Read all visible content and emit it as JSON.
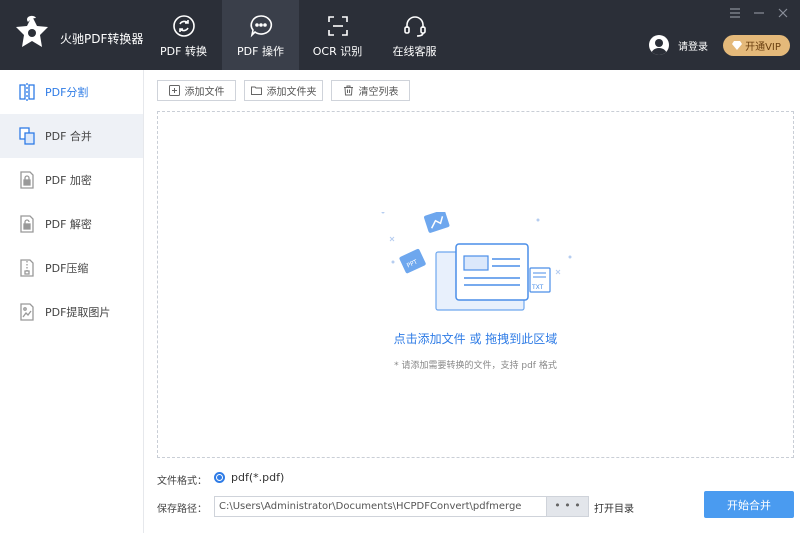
{
  "app": {
    "title": "火驰PDF转换器"
  },
  "nav": {
    "items": [
      {
        "label": "PDF 转换",
        "icon": "convert-icon"
      },
      {
        "label": "PDF 操作",
        "icon": "chat-bubble-icon",
        "active": true
      },
      {
        "label": "OCR 识别",
        "icon": "ocr-icon"
      },
      {
        "label": "在线客服",
        "icon": "headset-icon"
      }
    ]
  },
  "header": {
    "login": "请登录",
    "vip": "开通VIP"
  },
  "sidebar": {
    "items": [
      {
        "label": "PDF分割",
        "icon": "split-icon",
        "highlight": true
      },
      {
        "label": "PDF 合并",
        "icon": "merge-icon",
        "active": true
      },
      {
        "label": "PDF 加密",
        "icon": "lock-icon"
      },
      {
        "label": "PDF 解密",
        "icon": "unlock-icon"
      },
      {
        "label": "PDF压缩",
        "icon": "compress-icon"
      },
      {
        "label": "PDF提取图片",
        "icon": "extract-image-icon"
      }
    ]
  },
  "toolbar": {
    "add_file": "添加文件",
    "add_folder": "添加文件夹",
    "clear_list": "清空列表"
  },
  "dropzone": {
    "main_text": "点击添加文件 或 拖拽到此区域",
    "hint_text": "* 请添加需要转换的文件，支持 pdf 格式",
    "txt_tag": "TXT"
  },
  "output": {
    "format_label": "文件格式：",
    "format_value": "pdf(*.pdf)",
    "path_label": "保存路径：",
    "path_value": "C:\\Users\\Administrator\\Documents\\HCPDFConvert\\pdfmerge",
    "browse": "• • •",
    "open_dir": "打开目录",
    "start": "开始合并"
  },
  "colors": {
    "accent": "#2f7ce6",
    "topbar": "#2b2f38",
    "vip": "#e4b97a",
    "start": "#4a9bf0"
  }
}
